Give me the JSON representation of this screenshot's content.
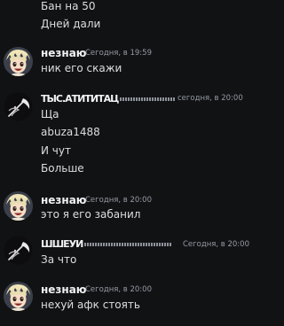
{
  "messages": {
    "top_lines": [
      "Бан на 50",
      "Дней дали"
    ],
    "m1": {
      "author": "незнаю",
      "timestamp": "Сегодня, в 19:59",
      "lines": [
        "ник его скажи"
      ]
    },
    "m2": {
      "author": "ТЫС.АТИТИТАЦ",
      "timestamp": "сегодня, в 20:00",
      "lines": [
        "Ща",
        "abuza1488",
        "И чут",
        "Больше"
      ]
    },
    "m3": {
      "author": "незнаю",
      "timestamp": "Сегодня, в 20:00",
      "lines": [
        "это я  его забанил"
      ]
    },
    "m4": {
      "author": "ШШЕУИ",
      "timestamp": "Сегодня, в 20:00",
      "lines": [
        "За что"
      ]
    },
    "m5": {
      "author": "незнаю",
      "timestamp": "Сегодня, в 20:00",
      "lines": [
        "нехуй афк стоять"
      ]
    }
  },
  "colors": {
    "background": "#111214",
    "text": "#dbdee1",
    "author": "#f2f3f5",
    "timestamp": "#949ba4"
  },
  "icons": {
    "anime_avatar": "anime-avatar-icon",
    "scythe_avatar": "scythe-avatar-icon"
  }
}
